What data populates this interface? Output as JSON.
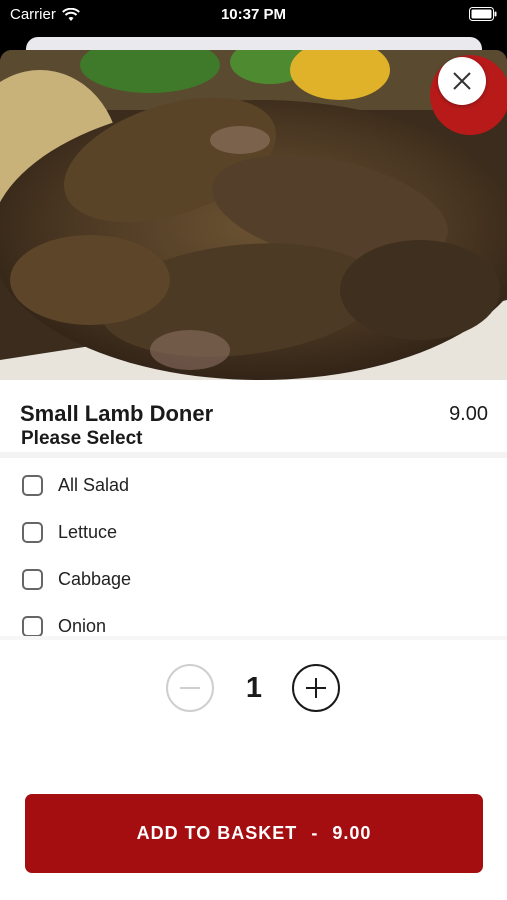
{
  "status_bar": {
    "carrier": "Carrier",
    "time": "10:37 PM"
  },
  "item": {
    "name": "Small Lamb Doner",
    "price": "9.00"
  },
  "options": {
    "title": "Please Select",
    "items": [
      {
        "label": "All Salad",
        "checked": false
      },
      {
        "label": "Lettuce",
        "checked": false
      },
      {
        "label": "Cabbage",
        "checked": false
      },
      {
        "label": "Onion",
        "checked": false
      }
    ]
  },
  "quantity": {
    "value": "1"
  },
  "add_button": {
    "label": "ADD TO BASKET",
    "separator": "-",
    "price": "9.00"
  },
  "colors": {
    "accent": "#a50e11"
  },
  "icons": {
    "close": "close-icon",
    "minus": "minus-icon",
    "plus": "plus-icon"
  }
}
